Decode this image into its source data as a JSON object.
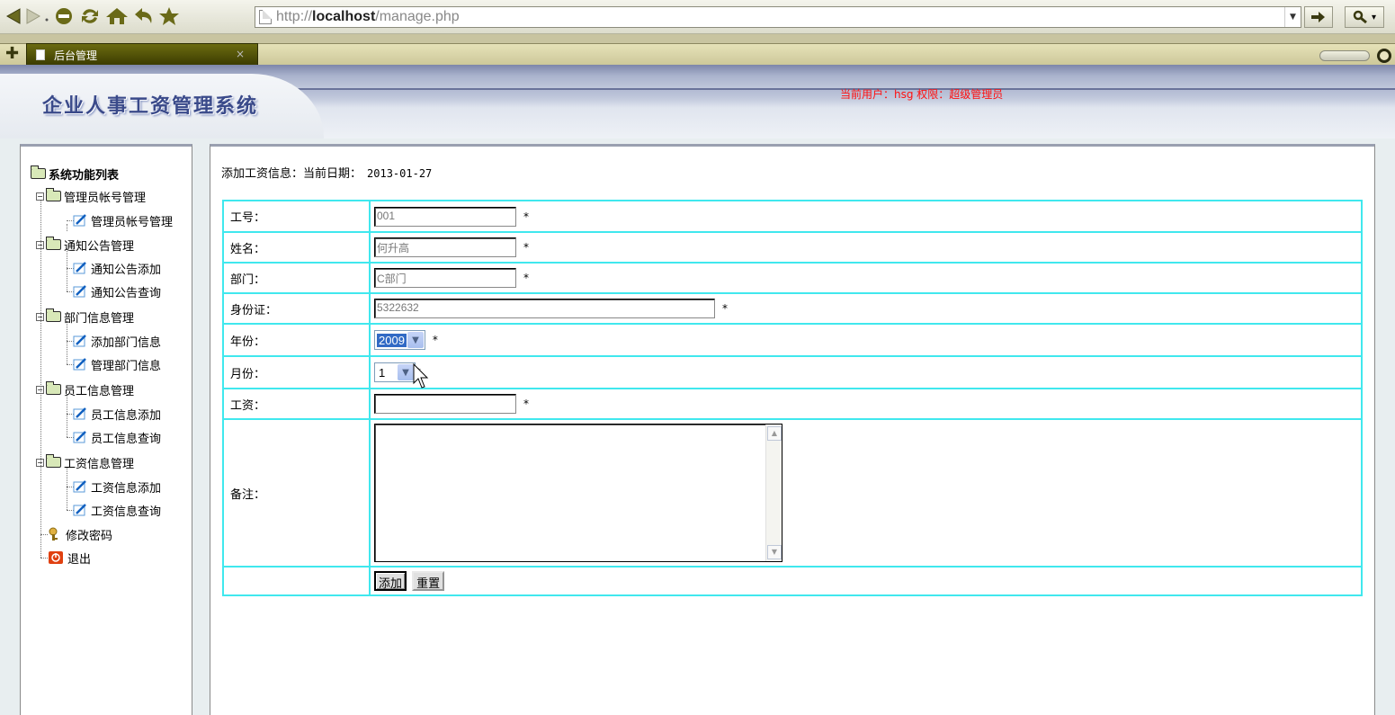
{
  "browser": {
    "url_prefix": "http://",
    "url_host": "localhost",
    "url_path": "/manage.php",
    "tab_title": "后台管理",
    "tab_close": "×"
  },
  "header": {
    "system_title": "企业人事工资管理系统",
    "user_info": "当前用户：hsg  权限：超级管理员"
  },
  "sidebar": {
    "root": "系统功能列表",
    "groups": [
      {
        "label": "管理员帐号管理",
        "items": [
          "管理员帐号管理"
        ]
      },
      {
        "label": "通知公告管理",
        "items": [
          "通知公告添加",
          "通知公告查询"
        ]
      },
      {
        "label": "部门信息管理",
        "items": [
          "添加部门信息",
          "管理部门信息"
        ]
      },
      {
        "label": "员工信息管理",
        "items": [
          "员工信息添加",
          "员工信息查询"
        ]
      },
      {
        "label": "工资信息管理",
        "items": [
          "工资信息添加",
          "工资信息查询"
        ]
      }
    ],
    "change_password": "修改密码",
    "logout": "退出"
  },
  "form": {
    "caption": "添加工资信息：当前日期：",
    "date": "2013-01-27",
    "fields": {
      "emp_no": {
        "label": "工号：",
        "value": "001"
      },
      "name": {
        "label": "姓名：",
        "value": "何升高"
      },
      "dept": {
        "label": "部门：",
        "value": "C部门"
      },
      "id_card": {
        "label": "身份证：",
        "value": "5322632"
      },
      "year": {
        "label": "年份：",
        "value": "2009"
      },
      "month": {
        "label": "月份：",
        "value": "1"
      },
      "salary": {
        "label": "工资：",
        "value": ""
      },
      "remark": {
        "label": "备注：",
        "value": ""
      }
    },
    "required_mark": "*",
    "submit_label": "添加",
    "reset_label": "重置"
  },
  "colors": {
    "table_border": "#40e8ee",
    "user_info": "#ff1010",
    "title": "#3a4a8a"
  }
}
